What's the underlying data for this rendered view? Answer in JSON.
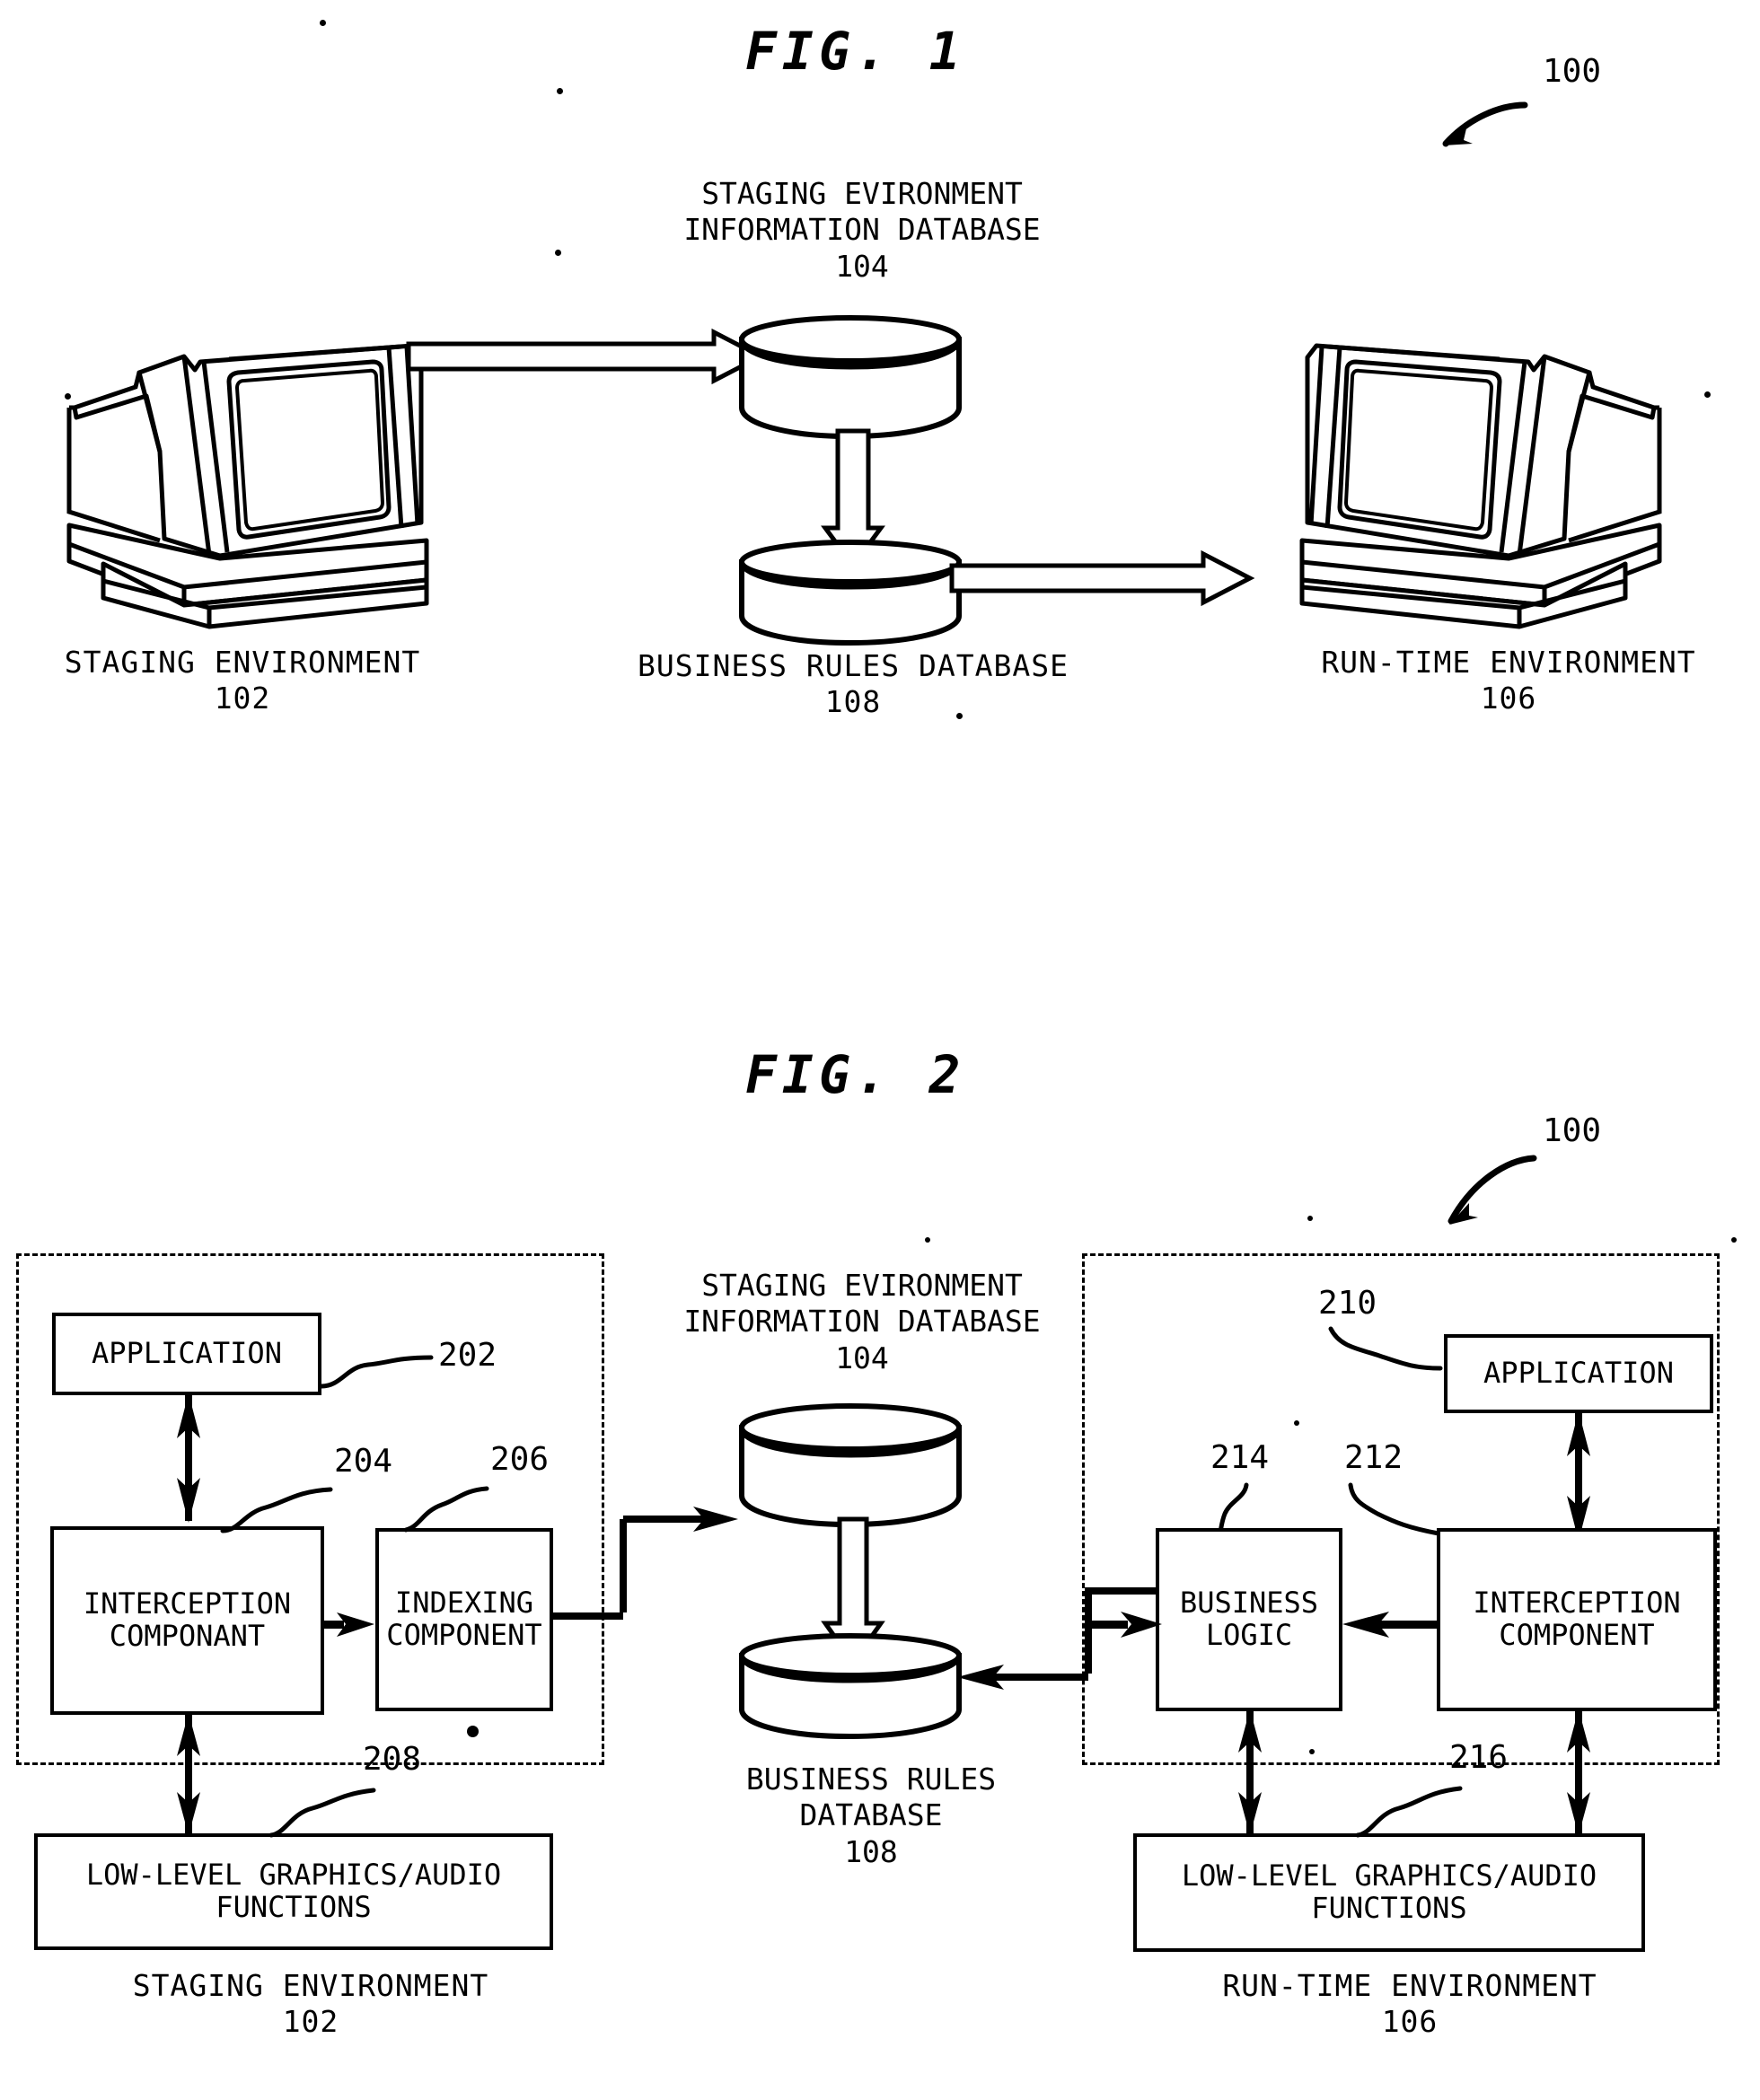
{
  "figure1": {
    "title": "FIG. 1",
    "system_ref": "100",
    "database_top": {
      "label_line1": "STAGING EVIRONMENT",
      "label_line2": "INFORMATION DATABASE",
      "ref": "104",
      "icon": "database-cylinder-icon"
    },
    "database_bottom": {
      "label_line1": "BUSINESS RULES DATABASE",
      "ref": "108",
      "icon": "database-cylinder-icon"
    },
    "staging_computer": {
      "label": "STAGING ENVIRONMENT",
      "ref": "102",
      "icon": "crt-computer-icon"
    },
    "runtime_computer": {
      "label": "RUN-TIME ENVIRONMENT",
      "ref": "106",
      "icon": "crt-computer-icon"
    },
    "arrows": [
      {
        "name": "staging-to-staging-db",
        "style": "hollow-block-arrow",
        "direction": "right"
      },
      {
        "name": "staging-db-to-rules-db",
        "style": "hollow-block-arrow",
        "direction": "down"
      },
      {
        "name": "rules-db-to-runtime",
        "style": "hollow-block-arrow",
        "direction": "right"
      }
    ]
  },
  "figure2": {
    "title": "FIG. 2",
    "system_ref": "100",
    "staging_panel": {
      "label": "STAGING ENVIRONMENT",
      "ref": "102",
      "blocks": [
        {
          "name": "application",
          "label": "APPLICATION",
          "ref": "202"
        },
        {
          "name": "interception-componant",
          "label": "INTERCEPTION\nCOMPONANT",
          "ref": "204"
        },
        {
          "name": "indexing-component",
          "label": "INDEXING\nCOMPONENT",
          "ref": "206"
        },
        {
          "name": "low-level-graphics-audio-functions",
          "label": "LOW-LEVEL GRAPHICS/AUDIO\nFUNCTIONS",
          "ref": "208"
        }
      ]
    },
    "runtime_panel": {
      "label": "RUN-TIME ENVIRONMENT",
      "ref": "106",
      "blocks": [
        {
          "name": "application",
          "label": "APPLICATION",
          "ref": "210"
        },
        {
          "name": "interception-component",
          "label": "INTERCEPTION\nCOMPONENT",
          "ref": "212"
        },
        {
          "name": "business-logic",
          "label": "BUSINESS\nLOGIC",
          "ref": "214"
        },
        {
          "name": "low-level-graphics-audio-functions",
          "label": "LOW-LEVEL GRAPHICS/AUDIO\nFUNCTIONS",
          "ref": "216"
        }
      ]
    },
    "database_top": {
      "label_line1": "STAGING EVIRONMENT",
      "label_line2": "INFORMATION DATABASE",
      "ref": "104",
      "icon": "database-cylinder-icon"
    },
    "database_bottom": {
      "label_line1": "BUSINESS RULES",
      "label_line2": "DATABASE",
      "ref": "108",
      "icon": "database-cylinder-icon"
    },
    "arrows": [
      {
        "name": "application-to-interception-staging",
        "style": "solid-double-arrow",
        "direction": "vertical"
      },
      {
        "name": "interception-to-indexing",
        "style": "solid-arrow",
        "direction": "right"
      },
      {
        "name": "interception-to-lowlevel-staging",
        "style": "solid-double-arrow",
        "direction": "vertical"
      },
      {
        "name": "indexing-to-staging-db",
        "style": "solid-arrow",
        "direction": "right"
      },
      {
        "name": "staging-db-to-rules-db",
        "style": "hollow-block-arrow",
        "direction": "down"
      },
      {
        "name": "business-logic-to-rules-db",
        "style": "solid-arrow",
        "direction": "left"
      },
      {
        "name": "rules-db-to-business-logic",
        "style": "solid-arrow",
        "direction": "right"
      },
      {
        "name": "interception-to-business-logic",
        "style": "solid-arrow",
        "direction": "left"
      },
      {
        "name": "application-to-interception-runtime",
        "style": "solid-double-arrow",
        "direction": "vertical"
      },
      {
        "name": "business-logic-to-lowlevel",
        "style": "solid-double-arrow",
        "direction": "vertical"
      },
      {
        "name": "interception-to-lowlevel-runtime",
        "style": "solid-double-arrow",
        "direction": "vertical"
      }
    ]
  },
  "colors": {
    "ink": "#000000",
    "paper": "#ffffff"
  }
}
